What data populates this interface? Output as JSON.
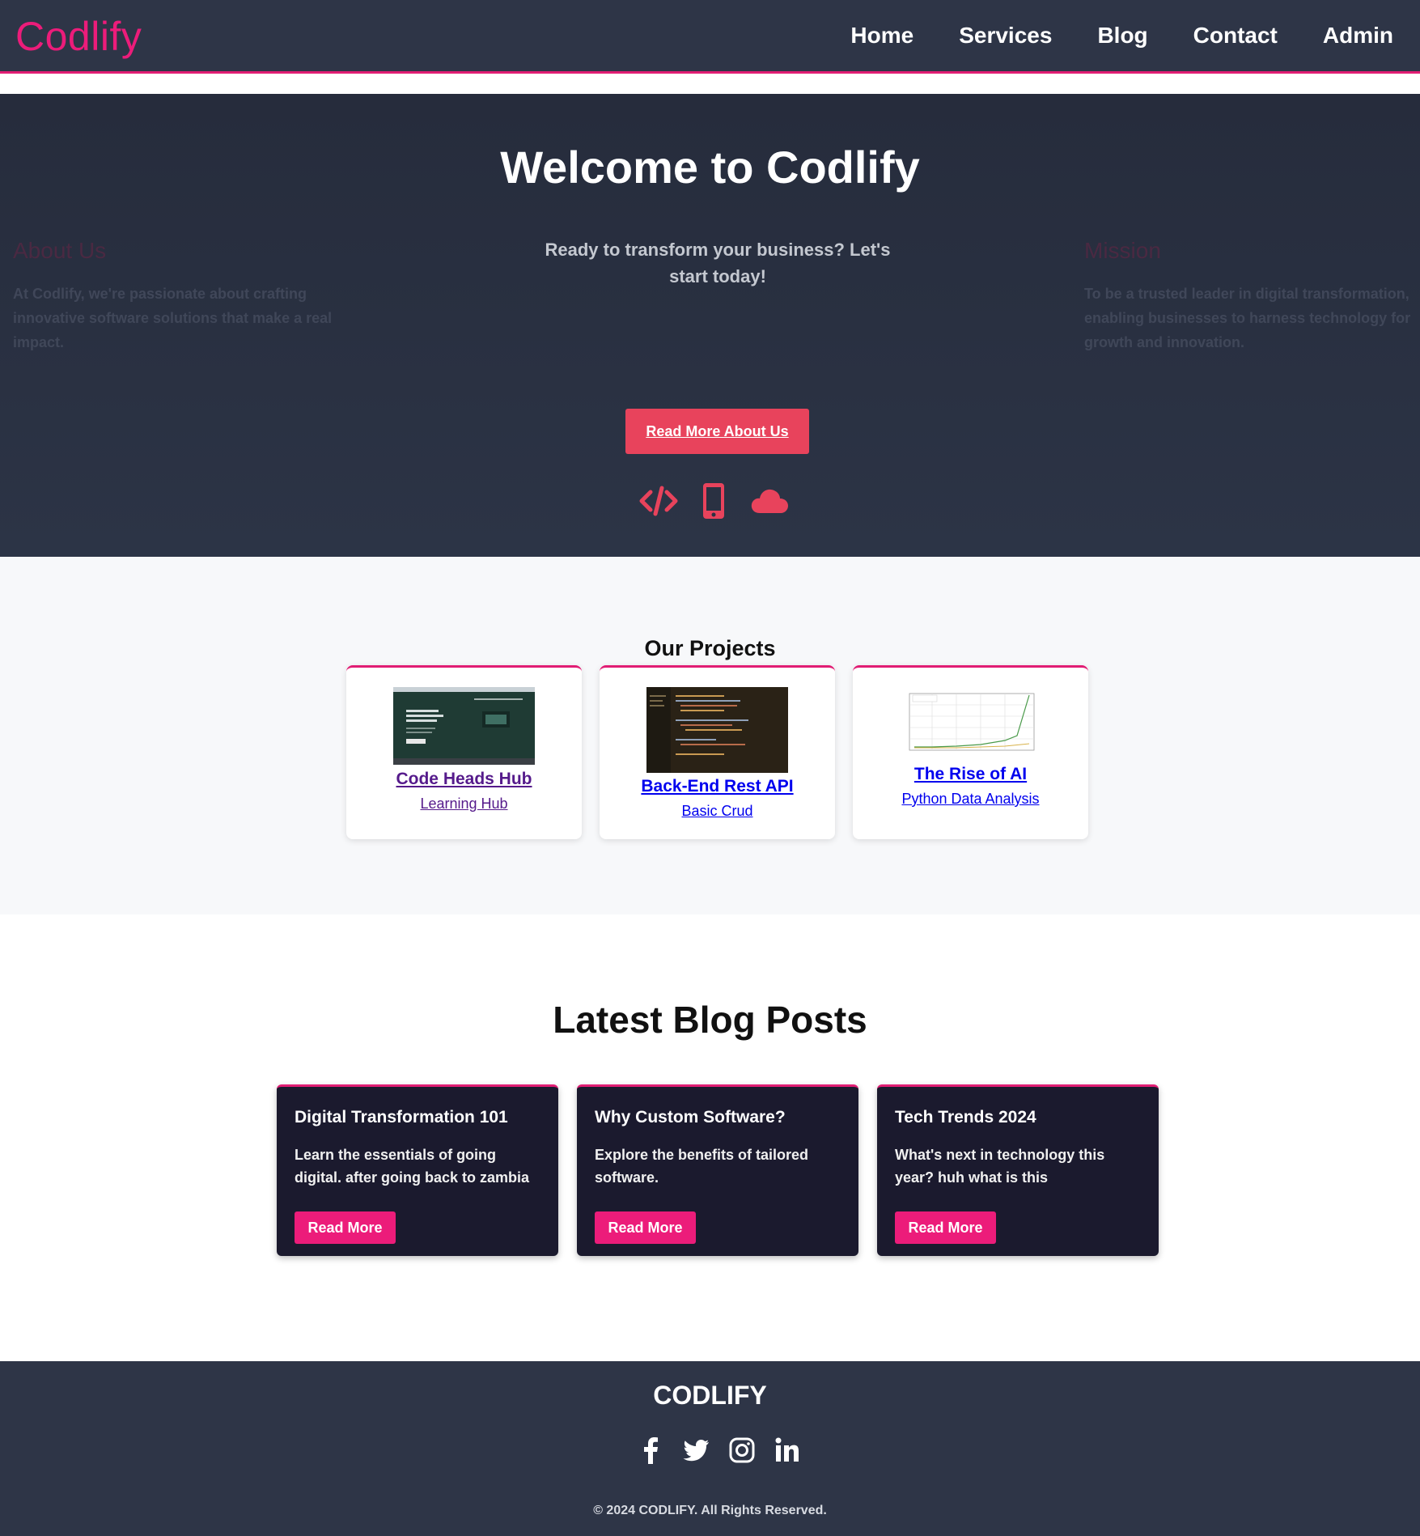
{
  "nav": {
    "logo": "Codlify",
    "links": [
      "Home",
      "Services",
      "Blog",
      "Contact",
      "Admin"
    ]
  },
  "hero": {
    "title": "Welcome to Codlify",
    "subtitle": "Ready to transform your business? Let's start today!",
    "about": {
      "heading": "About Us",
      "text": "At Codlify, we're passionate about crafting innovative software solutions that make a real impact."
    },
    "mission": {
      "heading": "Mission",
      "text": "To be a trusted leader in digital transformation, enabling businesses to harness technology for growth and innovation."
    },
    "button_label": "Read More About Us",
    "icons": [
      "code-icon",
      "mobile-icon",
      "cloud-icon"
    ]
  },
  "projects": {
    "title": "Our Projects",
    "items": [
      {
        "title": "Code Heads Hub",
        "subtitle": "Learning Hub"
      },
      {
        "title": "Back-End Rest API",
        "subtitle": "Basic Crud"
      },
      {
        "title": "The Rise of AI",
        "subtitle": "Python Data Analysis"
      }
    ]
  },
  "blog": {
    "title": "Latest Blog Posts",
    "posts": [
      {
        "title": "Digital Transformation 101",
        "text": "Learn the essentials of going digital. after going back to zambia",
        "button": "Read More"
      },
      {
        "title": "Why Custom Software?",
        "text": "Explore the benefits of tailored software.",
        "button": "Read More"
      },
      {
        "title": "Tech Trends 2024",
        "text": "What's next in technology this year? huh what is this",
        "button": "Read More"
      }
    ]
  },
  "footer": {
    "brand": "CODLIFY",
    "social": [
      "facebook-icon",
      "twitter-icon",
      "instagram-icon",
      "linkedin-icon"
    ],
    "copyright": "© 2024 CODLIFY. All Rights Reserved."
  },
  "colors": {
    "accent": "#ec1c7a",
    "nav_bg": "#2e3547",
    "hero_button": "#e8435c",
    "blog_card_bg": "#1b1a2e"
  }
}
